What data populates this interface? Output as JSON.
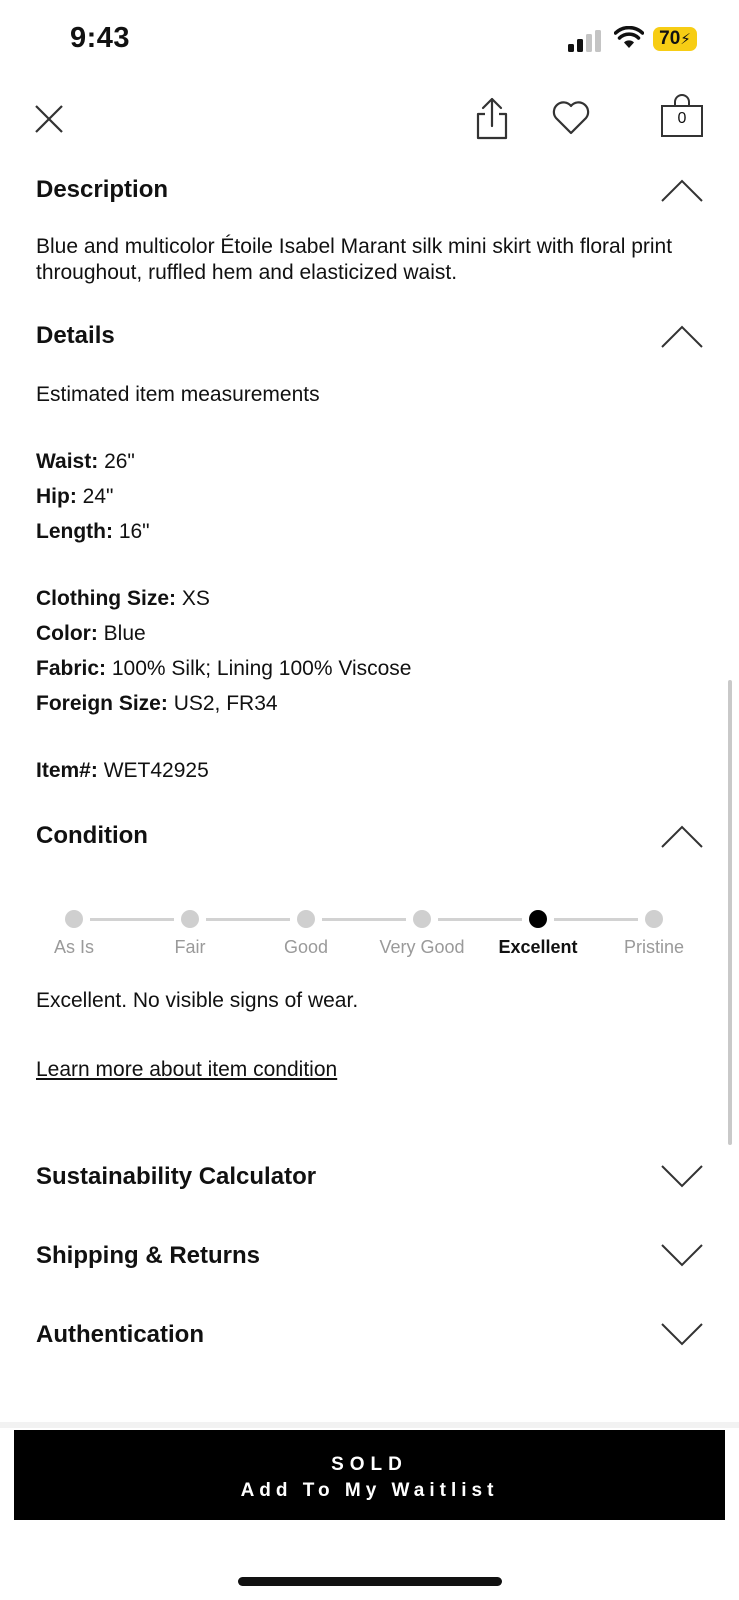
{
  "status_bar": {
    "time": "9:43",
    "battery": "70"
  },
  "nav": {
    "bag_count": "0"
  },
  "description": {
    "title": "Description",
    "text": "Blue and multicolor Étoile Isabel Marant silk mini skirt with floral print throughout, ruffled hem and elasticized waist."
  },
  "details": {
    "title": "Details",
    "intro": "Estimated item measurements",
    "specs": [
      {
        "label": "Waist:",
        "value": " 26\""
      },
      {
        "label": "Hip:",
        "value": " 24\""
      },
      {
        "label": "Length:",
        "value": " 16\""
      },
      {
        "label": "Clothing Size:",
        "value": " XS"
      },
      {
        "label": "Color:",
        "value": " Blue"
      },
      {
        "label": "Fabric:",
        "value": " 100% Silk; Lining 100% Viscose"
      },
      {
        "label": "Foreign Size:",
        "value": " US2, FR34"
      },
      {
        "label": "Item#:",
        "value": " WET42925"
      }
    ]
  },
  "condition": {
    "title": "Condition",
    "levels": [
      "As Is",
      "Fair",
      "Good",
      "Very Good",
      "Excellent",
      "Pristine"
    ],
    "selected_index": 4,
    "summary": "Excellent. No visible signs of wear.",
    "learn_more": "Learn more about item condition"
  },
  "collapsed_sections": [
    {
      "title": "Sustainability Calculator"
    },
    {
      "title": "Shipping & Returns"
    },
    {
      "title": "Authentication"
    }
  ],
  "cta": {
    "line1": "SOLD",
    "line2": "Add To My Waitlist"
  }
}
